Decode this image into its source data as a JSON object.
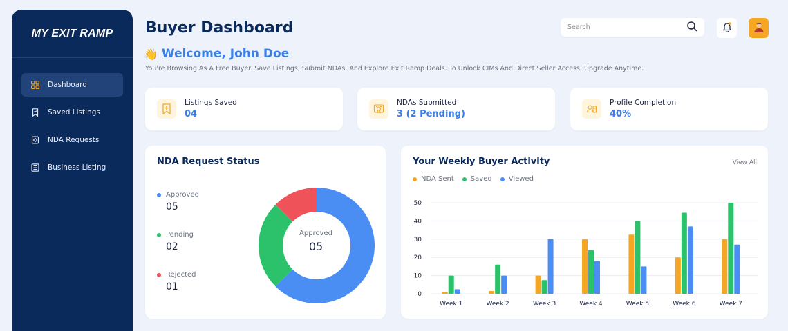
{
  "brand": {
    "logo_text": "MY EXIT RAMP"
  },
  "sidebar": {
    "items": [
      {
        "label": "Dashboard",
        "icon": "grid-icon",
        "active": true
      },
      {
        "label": "Saved Listings",
        "icon": "bookmark-icon"
      },
      {
        "label": "NDA Requests",
        "icon": "document-gear-icon"
      },
      {
        "label": "Business Listing",
        "icon": "list-icon"
      }
    ]
  },
  "header": {
    "title": "Buyer Dashboard",
    "search_placeholder": "Search",
    "welcome": "Welcome, John Doe",
    "subtitle": "You're Browsing As A Free Buyer. Save Listings, Submit NDAs, And Explore Exit Ramp Deals. To Unlock CIMs And Direct Seller Access, Upgrade Anytime."
  },
  "stats": [
    {
      "label": "Listings Saved",
      "value": "04",
      "icon": "bookmark-plus-icon"
    },
    {
      "label": "NDAs Submitted",
      "value": "3 (2 Pending)",
      "icon": "certificate-icon"
    },
    {
      "label": "Profile Completion",
      "value": "40%",
      "icon": "id-card-icon"
    }
  ],
  "nda_status": {
    "title": "NDA Request Status",
    "center_label": "Approved",
    "center_value": "05",
    "items": [
      {
        "label": "Approved",
        "value": "05",
        "count": 5,
        "color": "#4a8ef4"
      },
      {
        "label": "Pending",
        "value": "02",
        "count": 2,
        "color": "#2bc26b"
      },
      {
        "label": "Rejected",
        "value": "01",
        "count": 1,
        "color": "#f0525a"
      }
    ]
  },
  "activity": {
    "title": "Your Weekly Buyer Activity",
    "view_all": "View All"
  },
  "chart_data": {
    "type": "bar",
    "categories": [
      "Week 1",
      "Week 2",
      "Week 3",
      "Week 4",
      "Week 5",
      "Week 6",
      "Week 7"
    ],
    "series": [
      {
        "name": "NDA Sent",
        "color": "#f5a623",
        "values": [
          1,
          1.5,
          10,
          30,
          32.5,
          20,
          30
        ]
      },
      {
        "name": "Saved",
        "color": "#2bc26b",
        "values": [
          10,
          16,
          7.5,
          24,
          40,
          44.5,
          50
        ]
      },
      {
        "name": "Viewed",
        "color": "#4a8ef4",
        "values": [
          2.5,
          10,
          30,
          18,
          15,
          37,
          27
        ]
      }
    ],
    "ylim": [
      0,
      50
    ],
    "yticks": [
      0,
      10,
      20,
      30,
      40,
      50
    ],
    "grid": true,
    "legend": "top-left"
  }
}
